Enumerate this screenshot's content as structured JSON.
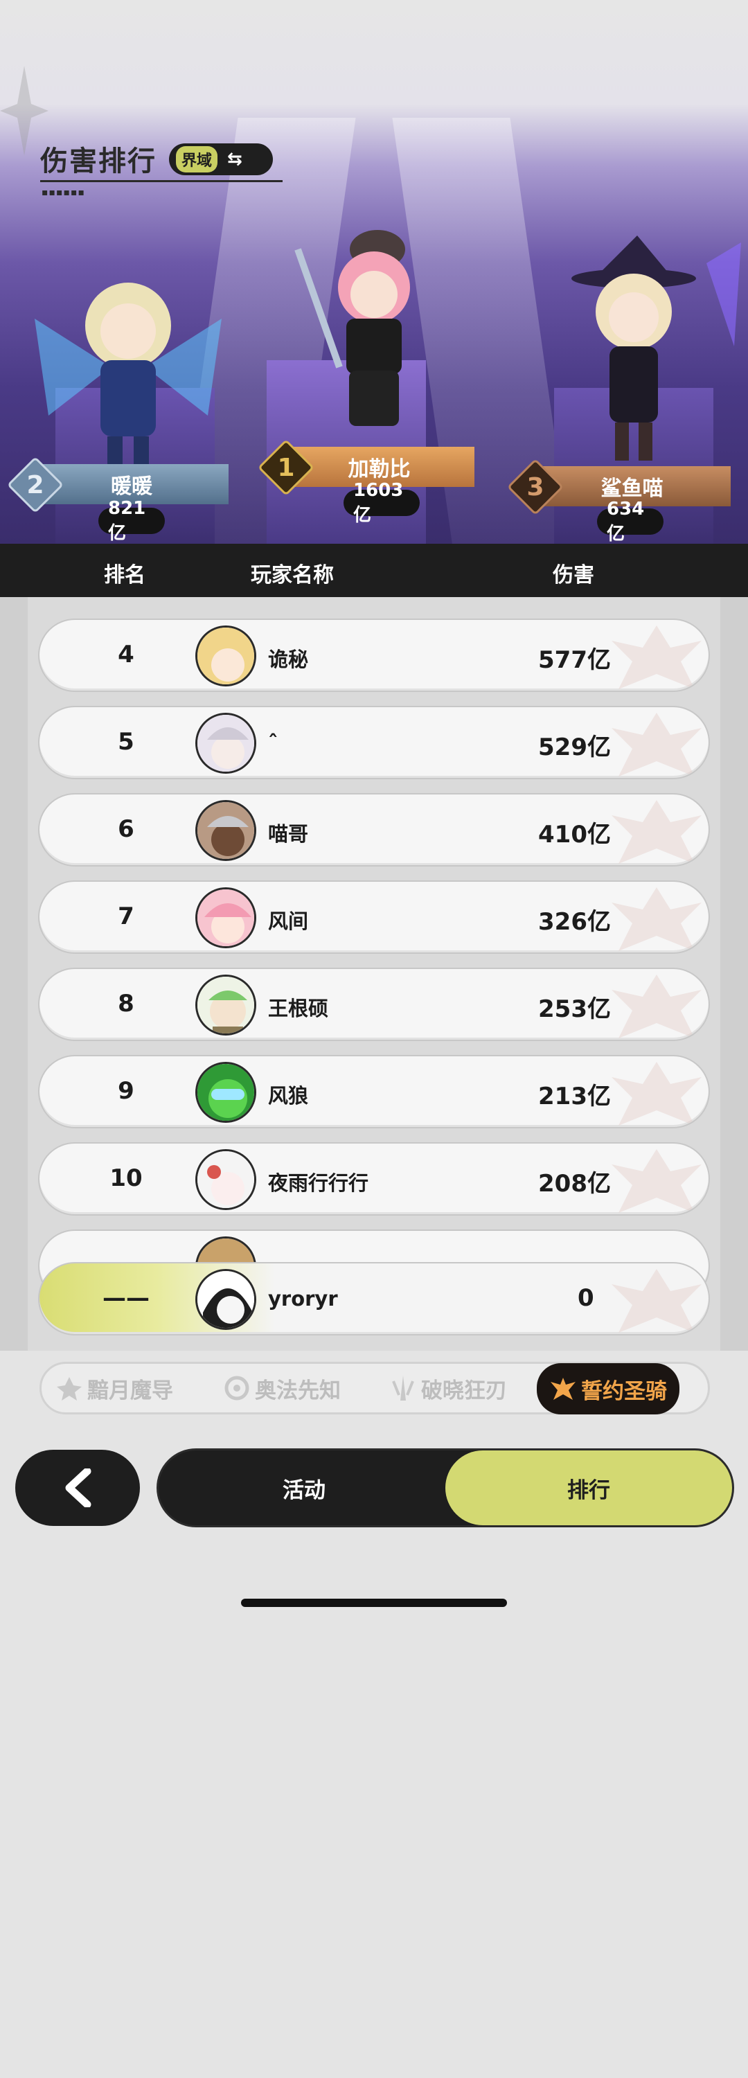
{
  "header": {
    "title": "伤害排行",
    "mode_tag": "界域",
    "mode_swap_icon": "⇆"
  },
  "podium": [
    {
      "rank": "2",
      "name": "暖暖",
      "damage": "821亿",
      "medal": "silver"
    },
    {
      "rank": "1",
      "name": "加勒比",
      "damage": "1603亿",
      "medal": "gold"
    },
    {
      "rank": "3",
      "name": "鲨鱼喵",
      "damage": "634亿",
      "medal": "bronze"
    }
  ],
  "table_header": {
    "rank": "排名",
    "player": "玩家名称",
    "damage": "伤害"
  },
  "rows": [
    {
      "rank": "4",
      "name": "诡秘",
      "damage": "577亿",
      "avatar_color": "#f1d58a"
    },
    {
      "rank": "5",
      "name": "ˆ",
      "damage": "529亿",
      "avatar_color": "#d9d4de"
    },
    {
      "rank": "6",
      "name": "喵哥",
      "damage": "410亿",
      "avatar_color": "#8a6a55"
    },
    {
      "rank": "7",
      "name": "风间",
      "damage": "326亿",
      "avatar_color": "#f3a6b8"
    },
    {
      "rank": "8",
      "name": "王根硕",
      "damage": "253亿",
      "avatar_color": "#9bd58c"
    },
    {
      "rank": "9",
      "name": "风狼",
      "damage": "213亿",
      "avatar_color": "#4cc04a"
    },
    {
      "rank": "10",
      "name": "夜雨行行行",
      "damage": "208亿",
      "avatar_color": "#eeeeee"
    }
  ],
  "self_row": {
    "rank": "——",
    "name": "yroryr",
    "damage": "0"
  },
  "class_tabs": [
    {
      "label": "黯月魔导",
      "active": false
    },
    {
      "label": "奥法先知",
      "active": false
    },
    {
      "label": "破晓狂刃",
      "active": false
    },
    {
      "label": "誓约圣骑",
      "active": true
    }
  ],
  "nav": {
    "activity": "活动",
    "ranking": "排行"
  },
  "colors": {
    "accent_lime": "#d3d972",
    "dark": "#1e1e1e",
    "active_tab_text": "#f2a54a"
  }
}
